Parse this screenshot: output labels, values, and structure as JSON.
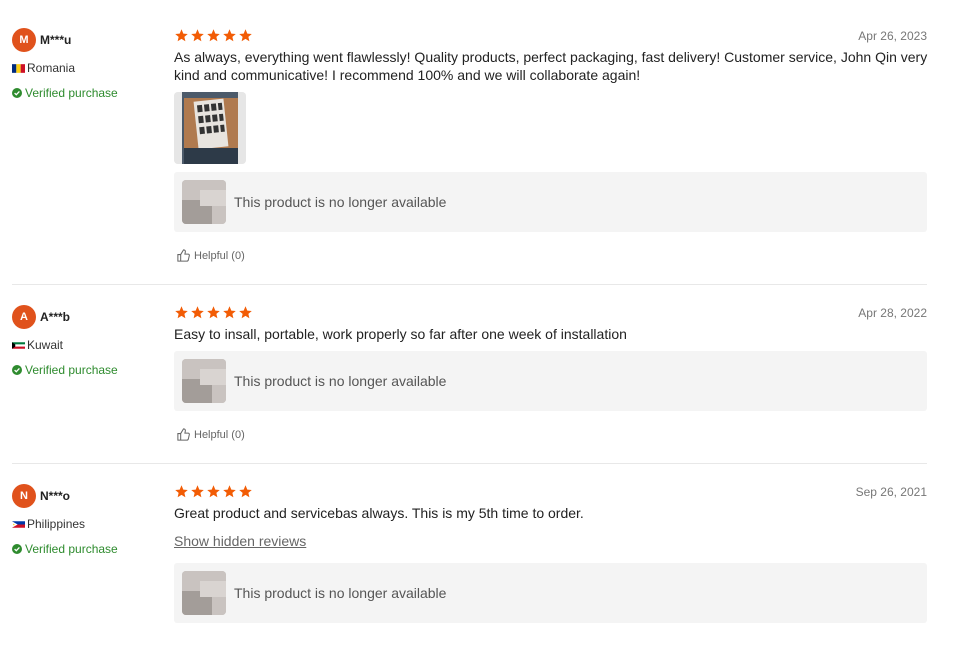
{
  "reviews": [
    {
      "initial": "M",
      "user": "M***u",
      "country": "Romania",
      "verified": "Verified purchase",
      "rating": 5,
      "date": "Apr 26, 2023",
      "text": "As always, everything went flawlessly! Quality products, perfect packaging, fast delivery! Customer service, John Qin very kind and communicative! I recommend 100% and we will collaborate again!",
      "product": "This product is no longer available",
      "helpful": "Helpful (0)"
    },
    {
      "initial": "A",
      "user": "A***b",
      "country": "Kuwait",
      "verified": "Verified purchase",
      "rating": 5,
      "date": "Apr 28, 2022",
      "text": "Easy to insall, portable, work properly so far after one week of installation",
      "product": "This product is no longer available",
      "helpful": "Helpful (0)"
    },
    {
      "initial": "N",
      "user": "N***o",
      "country": "Philippines",
      "verified": "Verified purchase",
      "rating": 5,
      "date": "Sep 26, 2021",
      "text": "Great product and servicebas always. This is my 5th time to order.",
      "show_hidden": "Show hidden reviews",
      "product": "This product is no longer available"
    }
  ],
  "colors": {
    "star": "#f25c05",
    "avatar": "#e0521c",
    "verified": "#2e8b2e"
  }
}
